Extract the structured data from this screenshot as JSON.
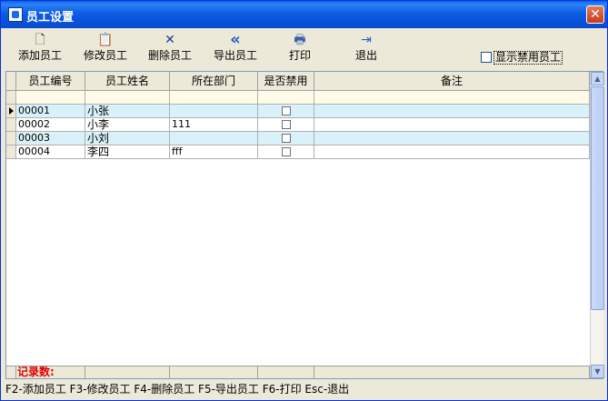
{
  "window": {
    "title": "员工设置",
    "close_symbol": "✕"
  },
  "toolbar": {
    "buttons": [
      {
        "label": "添加员工",
        "icon": "document-icon",
        "glyph": "🗋"
      },
      {
        "label": "修改员工",
        "icon": "clipboard-edit-icon",
        "glyph": "📋"
      },
      {
        "label": "删除员工",
        "icon": "delete-x-icon",
        "glyph": "✕"
      },
      {
        "label": "导出员工",
        "icon": "double-chevron-left-icon",
        "glyph": "«"
      },
      {
        "label": "打印",
        "icon": "printer-icon",
        "glyph": "🖶"
      },
      {
        "label": "退出",
        "icon": "exit-door-icon",
        "glyph": "⇥"
      }
    ],
    "show_disabled_label": "显示禁用员工",
    "show_disabled_checked": false
  },
  "grid": {
    "columns": [
      "员工编号",
      "员工姓名",
      "所在部门",
      "是否禁用",
      "备注"
    ],
    "rows": [
      {
        "id": "00001",
        "name": "小张",
        "dept": "",
        "disabled": false,
        "note": ""
      },
      {
        "id": "00002",
        "name": "小李",
        "dept": "111",
        "disabled": false,
        "note": ""
      },
      {
        "id": "00003",
        "name": "小刘",
        "dept": "",
        "disabled": false,
        "note": ""
      },
      {
        "id": "00004",
        "name": "李四",
        "dept": "fff",
        "disabled": false,
        "note": ""
      }
    ],
    "footer_label": "记录数:"
  },
  "statusbar": {
    "text": "F2-添加员工 F3-修改员工 F4-删除员工 F5-导出员工 F6-打印 Esc-退出"
  },
  "colors": {
    "title_bar": "#0a5fe8",
    "row_alt": "#d9f1f9",
    "filter_row": "#fffbe8",
    "footer_label": "#e00000"
  }
}
